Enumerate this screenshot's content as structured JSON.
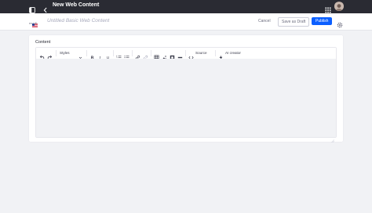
{
  "topbar": {
    "title": "New Web Content",
    "icons": [
      "sidebar-toggle-icon",
      "back-arrow-icon",
      "apps-grid-icon",
      "user-avatar"
    ]
  },
  "subbar": {
    "locale_code": "en-US",
    "doc_title_placeholder": "Untitled Basic Web Content",
    "cancel_label": "Cancel",
    "save_draft_label": "Save as Draft",
    "publish_label": "Publish"
  },
  "content": {
    "field_label": "Content",
    "toolbar": {
      "styles_label": "Styles",
      "source_label": "Source",
      "ai_creator_label": "AI creator",
      "icons": [
        "undo-icon",
        "redo-icon",
        "bold-icon",
        "italic-icon",
        "underline-icon",
        "numbered-list-icon",
        "bulleted-list-icon",
        "link-icon",
        "unlink-icon",
        "table-icon",
        "image-icon",
        "media-icon",
        "horizontal-rule-icon",
        "code-icon",
        "ai-icon"
      ]
    }
  },
  "colors": {
    "topbar_bg": "#2a2b33",
    "primary": "#0b5fff",
    "page_bg": "#f1f2f5"
  }
}
